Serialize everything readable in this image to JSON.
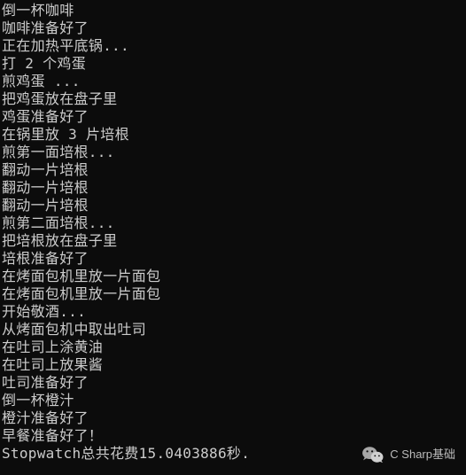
{
  "console": {
    "lines": [
      "倒一杯咖啡",
      "咖啡准备好了",
      "正在加热平底锅...",
      "打 2 个鸡蛋",
      "煎鸡蛋 ...",
      "把鸡蛋放在盘子里",
      "鸡蛋准备好了",
      "在锅里放 3 片培根",
      "煎第一面培根...",
      "翻动一片培根",
      "翻动一片培根",
      "翻动一片培根",
      "煎第二面培根...",
      "把培根放在盘子里",
      "培根准备好了",
      "在烤面包机里放一片面包",
      "在烤面包机里放一片面包",
      "开始敬酒...",
      "从烤面包机中取出吐司",
      "在吐司上涂黄油",
      "在吐司上放果酱",
      "吐司准备好了",
      "倒一杯橙汁",
      "橙汁准备好了",
      "早餐准备好了！",
      "Stopwatch总共花费15.0403886秒."
    ]
  },
  "watermark": {
    "label": "C Sharp基础",
    "icon": "wechat-icon"
  }
}
